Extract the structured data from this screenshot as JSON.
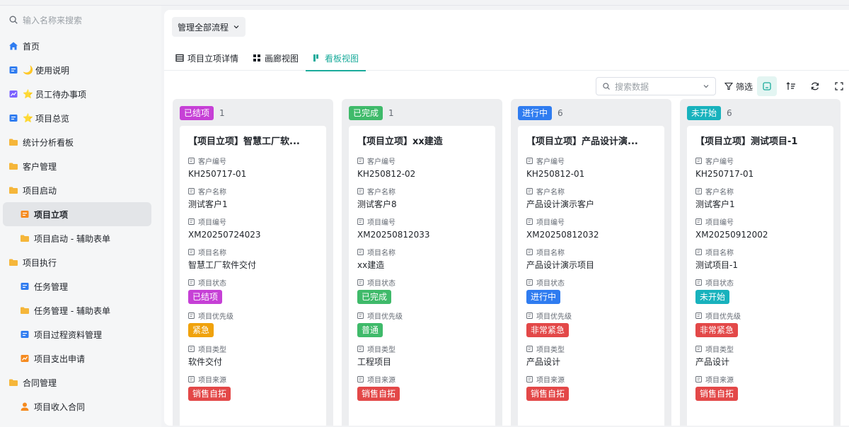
{
  "colors": {
    "accent": "#1aab9b",
    "purple": "#c640d6",
    "green": "#3fba6a",
    "blue": "#2f7cf0",
    "teal": "#18b2bd",
    "orange": "#f0a20c",
    "red": "#e34848"
  },
  "sidebar": {
    "search_placeholder": "输入名称来搜索",
    "items": [
      {
        "label": "首页",
        "icon": "home-icon",
        "emoji": ""
      },
      {
        "label": "使用说明",
        "icon": "doc-icon",
        "emoji": "🌙"
      },
      {
        "label": "员工待办事项",
        "icon": "chart-icon",
        "emoji": "⭐"
      },
      {
        "label": "项目总览",
        "icon": "doc-icon",
        "emoji": "⭐"
      },
      {
        "label": "统计分析看板",
        "icon": "folder-icon",
        "emoji": ""
      },
      {
        "label": "客户管理",
        "icon": "folder-icon",
        "emoji": ""
      },
      {
        "label": "项目启动",
        "icon": "folder-icon",
        "emoji": ""
      },
      {
        "label": "项目立项",
        "icon": "doc-icon",
        "emoji": ""
      },
      {
        "label": "项目启动 - 辅助表单",
        "icon": "folder-icon",
        "emoji": ""
      },
      {
        "label": "项目执行",
        "icon": "folder-icon",
        "emoji": ""
      },
      {
        "label": "任务管理",
        "icon": "doc-icon",
        "emoji": ""
      },
      {
        "label": "任务管理 - 辅助表单",
        "icon": "folder-icon",
        "emoji": ""
      },
      {
        "label": "项目过程资料管理",
        "icon": "doc-icon",
        "emoji": ""
      },
      {
        "label": "项目支出申请",
        "icon": "chart-icon",
        "emoji": ""
      },
      {
        "label": "合同管理",
        "icon": "folder-icon",
        "emoji": ""
      },
      {
        "label": "项目收入合同",
        "icon": "user-icon",
        "emoji": ""
      }
    ]
  },
  "flow_button": "管理全部流程",
  "tabs": [
    {
      "label": "项目立项详情",
      "icon": "table-icon"
    },
    {
      "label": "画廊视图",
      "icon": "grid-icon"
    },
    {
      "label": "看板视图",
      "icon": "kanban-icon"
    }
  ],
  "toolbar": {
    "search_placeholder": "搜索数据",
    "filter_label": "筛选"
  },
  "field_labels": {
    "customer_no": "客户编号",
    "customer_name": "客户名称",
    "project_no": "项目编号",
    "project_name": "项目名称",
    "status": "项目状态",
    "priority": "项目优先级",
    "type": "项目类型",
    "source": "项目来源"
  },
  "columns": [
    {
      "status": "已结项",
      "count": "1",
      "color": "#c640d6",
      "card": {
        "title": "【项目立项】智慧工厂软...",
        "customer_no": "KH250717-01",
        "customer_name": "测试客户1",
        "project_no": "XM20250724023",
        "project_name": "智慧工厂软件交付",
        "status": "已结项",
        "priority": "紧急",
        "priority_color": "#f0a20c",
        "type": "软件交付",
        "source": "销售自拓"
      }
    },
    {
      "status": "已完成",
      "count": "1",
      "color": "#3fba6a",
      "card": {
        "title": "【项目立项】xx建造",
        "customer_no": "KH250812-02",
        "customer_name": "测试客户8",
        "project_no": "XM20250812033",
        "project_name": "xx建造",
        "status": "已完成",
        "priority": "普通",
        "priority_color": "#3fba6a",
        "type": "工程项目",
        "source": "销售自拓"
      }
    },
    {
      "status": "进行中",
      "count": "6",
      "color": "#2f7cf0",
      "card": {
        "title": "【项目立项】产品设计演...",
        "customer_no": "KH250812-01",
        "customer_name": "产品设计演示客户",
        "project_no": "XM20250812032",
        "project_name": "产品设计演示项目",
        "status": "进行中",
        "priority": "非常紧急",
        "priority_color": "#e34848",
        "type": "产品设计",
        "source": "销售自拓"
      }
    },
    {
      "status": "未开始",
      "count": "6",
      "color": "#18b2bd",
      "card": {
        "title": "【项目立项】测试项目-1",
        "customer_no": "KH250717-01",
        "customer_name": "测试客户1",
        "project_no": "XM20250912002",
        "project_name": "测试项目-1",
        "status": "未开始",
        "priority": "非常紧急",
        "priority_color": "#e34848",
        "type": "产品设计",
        "source": "销售自拓"
      }
    }
  ]
}
